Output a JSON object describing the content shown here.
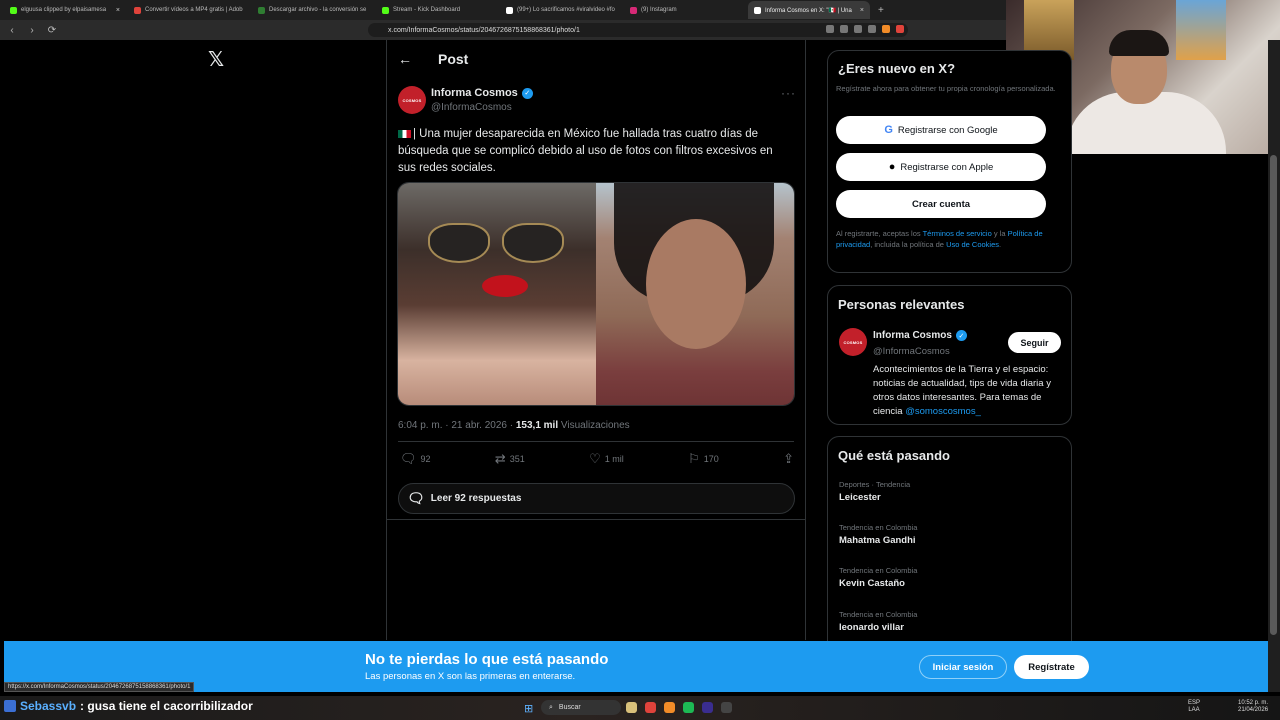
{
  "browser": {
    "tabs": [
      {
        "label": "elguusa clipped by elpaisamesa",
        "color": "#53fc18"
      },
      {
        "label": "Convertir vídeos a MP4 gratis | Adob",
        "color": "#e0433b"
      },
      {
        "label": "Descargar archivo - la conversión se",
        "color": "#2f7d32"
      },
      {
        "label": "Stream - Kick Dashboard",
        "color": "#53fc18"
      },
      {
        "label": "(99+) Lo sacrificamos #viralvideo #fo",
        "color": "#ffffff"
      },
      {
        "label": "(9) Instagram",
        "color": "#d62976"
      },
      {
        "label": "Informa Cosmos en X: \"🇲🇽 | Una",
        "color": "#ffffff",
        "active": true
      }
    ],
    "tab_close": "×",
    "new_tab": "+",
    "back": "‹",
    "forward": "›",
    "reload": "⟳",
    "url": "x.com/InformaCosmos/status/2046726875158868361/photo/1",
    "status_url": "https://x.com/InformaCosmos/status/2046726875158868361/photo/1"
  },
  "nav": {
    "logo": "𝕏"
  },
  "post": {
    "header_title": "Post",
    "back_icon": "←",
    "author_name": "Informa Cosmos",
    "author_handle": "@InformaCosmos",
    "avatar_text": "COSMOS",
    "verified_mark": "✓",
    "more": "···",
    "text": "| Una mujer desaparecida en México fue hallada tras cuatro días de búsqueda que se complicó debido al uso de fotos con filtros excesivos en sus redes sociales.",
    "time": "6:04 p. m. · 21 abr. 2026 · ",
    "views_count": "153,1 mil",
    "views_label": " Visualizaciones",
    "actions": {
      "replies": "92",
      "reposts": "351",
      "likes": "1 mil",
      "bookmarks": "170"
    },
    "read_replies": "Leer 92 respuestas"
  },
  "signup": {
    "title": "¿Eres nuevo en X?",
    "desc": "Regístrate ahora para obtener tu propia cronología personalizada.",
    "google": "Registrarse con Google",
    "apple": "Registrarse con Apple",
    "create": "Crear cuenta",
    "legal_pre": "Al registrarte, aceptas los ",
    "legal_terms": "Términos de servicio",
    "legal_and": " y la ",
    "legal_privacy": "Política de privacidad",
    "legal_mid": ", incluida la política de ",
    "legal_cookies": "Uso de Cookies",
    "legal_end": "."
  },
  "people": {
    "title": "Personas relevantes",
    "name": "Informa Cosmos",
    "handle": "@InformaCosmos",
    "follow": "Seguir",
    "bio": "Acontecimientos de la Tierra y el espacio: noticias de actualidad, tips de vida diaria y otros datos interesantes. Para temas de ciencia ",
    "bio_link": "@somoscosmos_"
  },
  "trends": {
    "title": "Qué está pasando",
    "items": [
      {
        "context": "Deportes · Tendencia",
        "name": "Leicester"
      },
      {
        "context": "Tendencia en Colombia",
        "name": "Mahatma Gandhi"
      },
      {
        "context": "Tendencia en Colombia",
        "name": "Kevin Castaño"
      },
      {
        "context": "Tendencia en Colombia",
        "name": "leonardo villar"
      }
    ]
  },
  "banner": {
    "title": "No te pierdas lo que está pasando",
    "subtitle": "Las personas en X son las primeras en enterarse.",
    "login": "Iniciar sesión",
    "register": "Regístrate"
  },
  "stream": {
    "chat_user": "Sebassvb",
    "chat_text": ": gusa tiene el cacorribilizador"
  },
  "taskbar": {
    "search": "Buscar",
    "lang": "ESP",
    "lang_sub": "LAA",
    "time": "10:52 p. m.",
    "date": "21/04/2026"
  },
  "colors": {
    "accent": "#1d9bf0",
    "background": "#000000",
    "border": "#2f3336",
    "muted_text": "#71767b"
  }
}
